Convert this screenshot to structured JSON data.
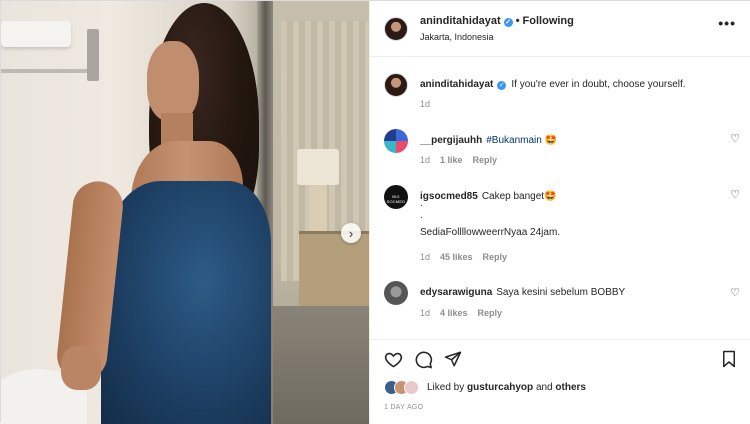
{
  "post": {
    "username": "aninditahidayat",
    "verified_mark": "✓",
    "following_label": "Following",
    "separator": "•",
    "location": "Jakarta, Indonesia",
    "more_icon": "•••",
    "photo_alt": "Woman in blue satin halter dress in a hotel bathroom",
    "carousel_next": "›"
  },
  "caption": {
    "username": "aninditahidayat",
    "text": "If you're ever in doubt, choose yourself.",
    "time": "1d"
  },
  "comments": [
    {
      "username": "__pergijauhh",
      "text_hashtag": "#Bukanmain",
      "text_rest": " 🤩",
      "time": "1d",
      "likes": "1 like",
      "reply": "Reply"
    },
    {
      "username": "igsocmed85",
      "text": "Cakep banget🤩",
      "extra_lines": [
        ".",
        ".",
        "SediaFollllowweerrNyaa 24jam."
      ],
      "time": "1d",
      "likes": "45 likes",
      "reply": "Reply",
      "avatar_text": "BIG SOCMED"
    },
    {
      "username": "edysarawiguna",
      "text": "Saya kesini sebelum BOBBY",
      "time": "1d",
      "likes": "4 likes",
      "reply": "Reply"
    }
  ],
  "actions": {
    "like_icon": "heart-icon",
    "comment_icon": "comment-icon",
    "share_icon": "share-icon",
    "save_icon": "bookmark-icon"
  },
  "likes": {
    "prefix": "Liked by",
    "user": "gusturcahyop",
    "joiner": "and",
    "others": "others"
  },
  "time_ago": "1 DAY AGO",
  "colors": {
    "text": "#262626",
    "muted": "#8e8e8e",
    "verified": "#3897f0",
    "hashtag": "#00376b"
  }
}
